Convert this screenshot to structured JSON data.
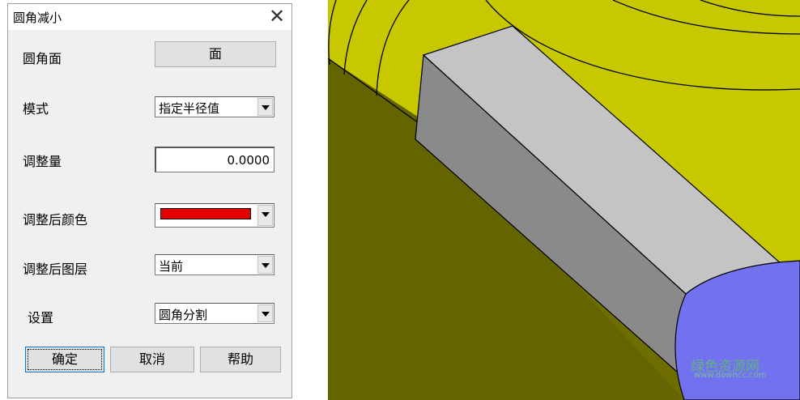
{
  "dialog": {
    "title": "圆角减小",
    "close_glyph": "✕",
    "rows": {
      "face_label": "圆角面",
      "face_button": "面",
      "mode_label": "模式",
      "mode_value": "指定半径值",
      "adjust_label": "调整量",
      "adjust_value": "0.0000",
      "color_label": "调整后颜色",
      "color_value": "#e00000",
      "layer_label": "调整后图层",
      "layer_value": "当前",
      "settings_label": "设置",
      "settings_value": "圆角分割"
    },
    "buttons": {
      "ok": "确定",
      "cancel": "取消",
      "help": "帮助"
    }
  },
  "viewport": {
    "colors": {
      "yellow": "#c8c800",
      "dark_yellow": "#6e6e00",
      "gray_top": "#c0c0c0",
      "gray_side": "#888888",
      "blue": "#7070f0"
    },
    "watermark": "绿色资源网",
    "watermark_url": "www.downcc.com"
  }
}
